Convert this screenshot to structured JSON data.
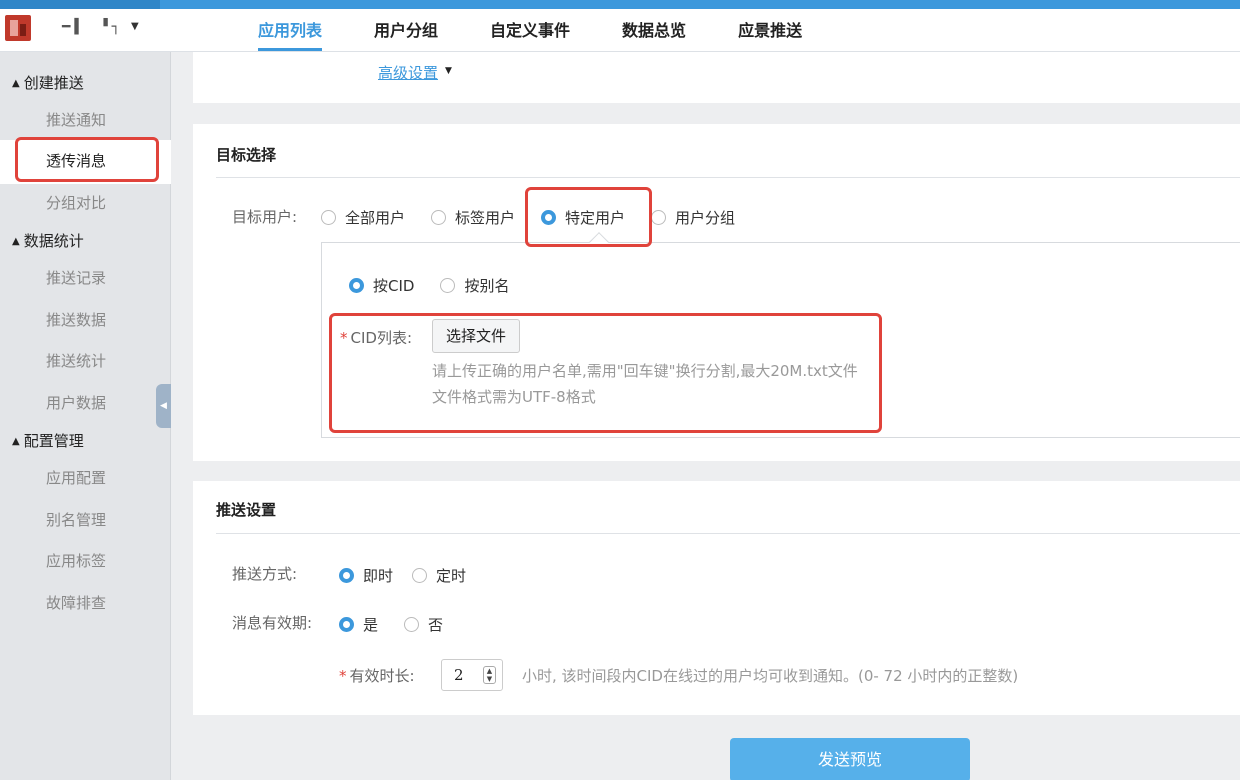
{
  "app": {
    "name_glyphs": "━▌ ▝┐"
  },
  "topnav": {
    "tabs": [
      {
        "label": "应用列表",
        "active": true
      },
      {
        "label": "用户分组"
      },
      {
        "label": "自定义事件"
      },
      {
        "label": "数据总览"
      },
      {
        "label": "应景推送"
      }
    ]
  },
  "sidebar": {
    "groups": [
      {
        "label": "创建推送",
        "items": [
          "推送通知",
          "透传消息",
          "分组对比"
        ]
      },
      {
        "label": "数据统计",
        "items": [
          "推送记录",
          "推送数据",
          "推送统计",
          "用户数据"
        ]
      },
      {
        "label": "配置管理",
        "items": [
          "应用配置",
          "别名管理",
          "应用标签",
          "故障排查"
        ]
      }
    ],
    "selected": "透传消息"
  },
  "advanced": {
    "label": "高级设置"
  },
  "target": {
    "title": "目标选择",
    "label": "目标用户:",
    "options": [
      "全部用户",
      "标签用户",
      "特定用户",
      "用户分组"
    ],
    "selected": "特定用户",
    "mode_options": [
      "按CID",
      "按别名"
    ],
    "mode_selected": "按CID",
    "cid_label": "CID列表:",
    "file_button": "选择文件",
    "hint1": "请上传正确的用户名单,需用\"回车键\"换行分割,最大20M.txt文件",
    "hint2": "文件格式需为UTF-8格式"
  },
  "push": {
    "title": "推送设置",
    "method_label": "推送方式:",
    "method_options": [
      "即时",
      "定时"
    ],
    "method_selected": "即时",
    "validity_label": "消息有效期:",
    "validity_options": [
      "是",
      "否"
    ],
    "validity_selected": "是",
    "duration_label": "有效时长:",
    "duration_value": "2",
    "duration_hint": "小时, 该时间段内CID在线过的用户均可收到通知。(0- 72 小时内的正整数)"
  },
  "send_button": "发送预览",
  "colors": {
    "accent": "#3c98dc",
    "highlight": "#e0433b",
    "button": "#56b0ea"
  }
}
